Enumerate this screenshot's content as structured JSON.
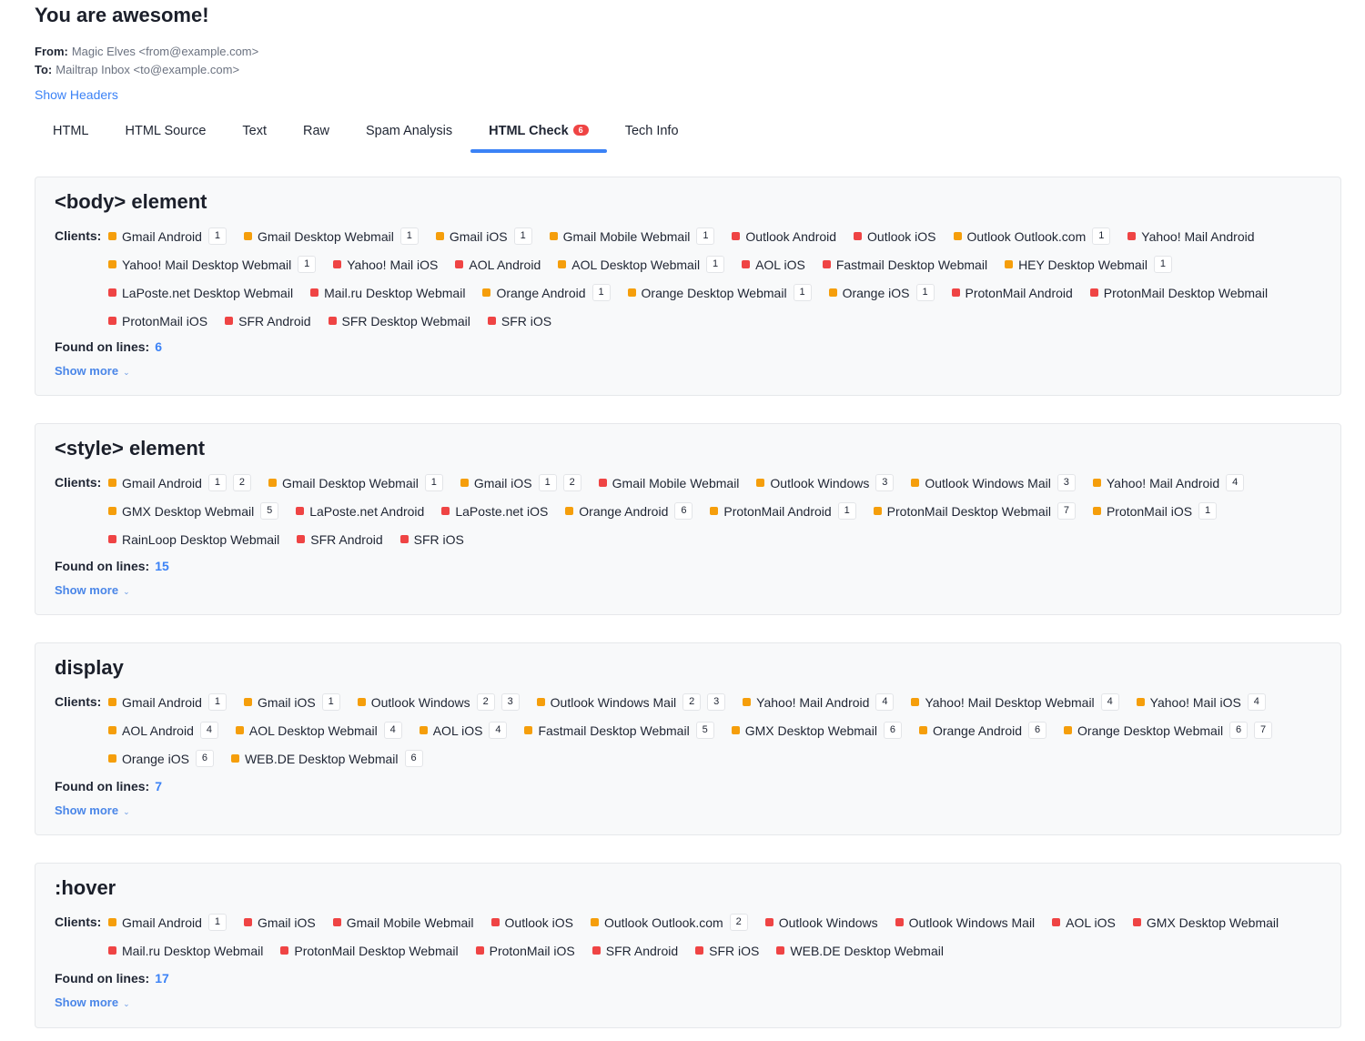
{
  "email": {
    "subject": "You are awesome!",
    "from_label": "From:",
    "from_value": "Magic Elves <from@example.com>",
    "to_label": "To:",
    "to_value": "Mailtrap Inbox <to@example.com>",
    "show_headers": "Show Headers"
  },
  "tabs": [
    {
      "label": "HTML"
    },
    {
      "label": "HTML Source"
    },
    {
      "label": "Text"
    },
    {
      "label": "Raw"
    },
    {
      "label": "Spam Analysis"
    },
    {
      "label": "HTML Check",
      "badge": "6",
      "active": true
    },
    {
      "label": "Tech Info"
    }
  ],
  "colors": {
    "partial": "#f59e0b",
    "unsupported": "#ef4444",
    "accent": "#3b82f6"
  },
  "labels": {
    "clients": "Clients:",
    "found_on_lines": "Found on lines:",
    "show_more": "Show more"
  },
  "sections": [
    {
      "title": "<body> element",
      "lines": "6",
      "clients": [
        {
          "name": "Gmail Android",
          "status": "orange",
          "notes": [
            "1"
          ]
        },
        {
          "name": "Gmail Desktop Webmail",
          "status": "orange",
          "notes": [
            "1"
          ]
        },
        {
          "name": "Gmail iOS",
          "status": "orange",
          "notes": [
            "1"
          ]
        },
        {
          "name": "Gmail Mobile Webmail",
          "status": "orange",
          "notes": [
            "1"
          ]
        },
        {
          "name": "Outlook Android",
          "status": "red",
          "notes": []
        },
        {
          "name": "Outlook iOS",
          "status": "red",
          "notes": []
        },
        {
          "name": "Outlook Outlook.com",
          "status": "orange",
          "notes": [
            "1"
          ]
        },
        {
          "name": "Yahoo! Mail Android",
          "status": "red",
          "notes": []
        },
        {
          "name": "Yahoo! Mail Desktop Webmail",
          "status": "orange",
          "notes": [
            "1"
          ]
        },
        {
          "name": "Yahoo! Mail iOS",
          "status": "red",
          "notes": []
        },
        {
          "name": "AOL Android",
          "status": "red",
          "notes": []
        },
        {
          "name": "AOL Desktop Webmail",
          "status": "orange",
          "notes": [
            "1"
          ]
        },
        {
          "name": "AOL iOS",
          "status": "red",
          "notes": []
        },
        {
          "name": "Fastmail Desktop Webmail",
          "status": "red",
          "notes": []
        },
        {
          "name": "HEY Desktop Webmail",
          "status": "orange",
          "notes": [
            "1"
          ]
        },
        {
          "name": "LaPoste.net Desktop Webmail",
          "status": "red",
          "notes": []
        },
        {
          "name": "Mail.ru Desktop Webmail",
          "status": "red",
          "notes": []
        },
        {
          "name": "Orange Android",
          "status": "orange",
          "notes": [
            "1"
          ]
        },
        {
          "name": "Orange Desktop Webmail",
          "status": "orange",
          "notes": [
            "1"
          ]
        },
        {
          "name": "Orange iOS",
          "status": "orange",
          "notes": [
            "1"
          ]
        },
        {
          "name": "ProtonMail Android",
          "status": "red",
          "notes": []
        },
        {
          "name": "ProtonMail Desktop Webmail",
          "status": "red",
          "notes": []
        },
        {
          "name": "ProtonMail iOS",
          "status": "red",
          "notes": []
        },
        {
          "name": "SFR Android",
          "status": "red",
          "notes": []
        },
        {
          "name": "SFR Desktop Webmail",
          "status": "red",
          "notes": []
        },
        {
          "name": "SFR iOS",
          "status": "red",
          "notes": []
        }
      ]
    },
    {
      "title": "<style> element",
      "lines": "15",
      "clients": [
        {
          "name": "Gmail Android",
          "status": "orange",
          "notes": [
            "1",
            "2"
          ]
        },
        {
          "name": "Gmail Desktop Webmail",
          "status": "orange",
          "notes": [
            "1"
          ]
        },
        {
          "name": "Gmail iOS",
          "status": "orange",
          "notes": [
            "1",
            "2"
          ]
        },
        {
          "name": "Gmail Mobile Webmail",
          "status": "red",
          "notes": []
        },
        {
          "name": "Outlook Windows",
          "status": "orange",
          "notes": [
            "3"
          ]
        },
        {
          "name": "Outlook Windows Mail",
          "status": "orange",
          "notes": [
            "3"
          ]
        },
        {
          "name": "Yahoo! Mail Android",
          "status": "orange",
          "notes": [
            "4"
          ]
        },
        {
          "name": "GMX Desktop Webmail",
          "status": "orange",
          "notes": [
            "5"
          ]
        },
        {
          "name": "LaPoste.net Android",
          "status": "red",
          "notes": []
        },
        {
          "name": "LaPoste.net iOS",
          "status": "red",
          "notes": []
        },
        {
          "name": "Orange Android",
          "status": "orange",
          "notes": [
            "6"
          ]
        },
        {
          "name": "ProtonMail Android",
          "status": "orange",
          "notes": [
            "1"
          ]
        },
        {
          "name": "ProtonMail Desktop Webmail",
          "status": "orange",
          "notes": [
            "7"
          ]
        },
        {
          "name": "ProtonMail iOS",
          "status": "orange",
          "notes": [
            "1"
          ]
        },
        {
          "name": "RainLoop Desktop Webmail",
          "status": "red",
          "notes": []
        },
        {
          "name": "SFR Android",
          "status": "red",
          "notes": []
        },
        {
          "name": "SFR iOS",
          "status": "red",
          "notes": []
        }
      ]
    },
    {
      "title": "display",
      "lines": "7",
      "clients": [
        {
          "name": "Gmail Android",
          "status": "orange",
          "notes": [
            "1"
          ]
        },
        {
          "name": "Gmail iOS",
          "status": "orange",
          "notes": [
            "1"
          ]
        },
        {
          "name": "Outlook Windows",
          "status": "orange",
          "notes": [
            "2",
            "3"
          ]
        },
        {
          "name": "Outlook Windows Mail",
          "status": "orange",
          "notes": [
            "2",
            "3"
          ]
        },
        {
          "name": "Yahoo! Mail Android",
          "status": "orange",
          "notes": [
            "4"
          ]
        },
        {
          "name": "Yahoo! Mail Desktop Webmail",
          "status": "orange",
          "notes": [
            "4"
          ]
        },
        {
          "name": "Yahoo! Mail iOS",
          "status": "orange",
          "notes": [
            "4"
          ]
        },
        {
          "name": "AOL Android",
          "status": "orange",
          "notes": [
            "4"
          ]
        },
        {
          "name": "AOL Desktop Webmail",
          "status": "orange",
          "notes": [
            "4"
          ]
        },
        {
          "name": "AOL iOS",
          "status": "orange",
          "notes": [
            "4"
          ]
        },
        {
          "name": "Fastmail Desktop Webmail",
          "status": "orange",
          "notes": [
            "5"
          ]
        },
        {
          "name": "GMX Desktop Webmail",
          "status": "orange",
          "notes": [
            "6"
          ]
        },
        {
          "name": "Orange Android",
          "status": "orange",
          "notes": [
            "6"
          ]
        },
        {
          "name": "Orange Desktop Webmail",
          "status": "orange",
          "notes": [
            "6",
            "7"
          ]
        },
        {
          "name": "Orange iOS",
          "status": "orange",
          "notes": [
            "6"
          ]
        },
        {
          "name": "WEB.DE Desktop Webmail",
          "status": "orange",
          "notes": [
            "6"
          ]
        }
      ]
    },
    {
      "title": ":hover",
      "lines": "17",
      "clients": [
        {
          "name": "Gmail Android",
          "status": "orange",
          "notes": [
            "1"
          ]
        },
        {
          "name": "Gmail iOS",
          "status": "red",
          "notes": []
        },
        {
          "name": "Gmail Mobile Webmail",
          "status": "red",
          "notes": []
        },
        {
          "name": "Outlook iOS",
          "status": "red",
          "notes": []
        },
        {
          "name": "Outlook Outlook.com",
          "status": "orange",
          "notes": [
            "2"
          ]
        },
        {
          "name": "Outlook Windows",
          "status": "red",
          "notes": []
        },
        {
          "name": "Outlook Windows Mail",
          "status": "red",
          "notes": []
        },
        {
          "name": "AOL iOS",
          "status": "red",
          "notes": []
        },
        {
          "name": "GMX Desktop Webmail",
          "status": "red",
          "notes": []
        },
        {
          "name": "Mail.ru Desktop Webmail",
          "status": "red",
          "notes": []
        },
        {
          "name": "ProtonMail Desktop Webmail",
          "status": "red",
          "notes": []
        },
        {
          "name": "ProtonMail iOS",
          "status": "red",
          "notes": []
        },
        {
          "name": "SFR Android",
          "status": "red",
          "notes": []
        },
        {
          "name": "SFR iOS",
          "status": "red",
          "notes": []
        },
        {
          "name": "WEB.DE Desktop Webmail",
          "status": "red",
          "notes": []
        }
      ]
    }
  ]
}
